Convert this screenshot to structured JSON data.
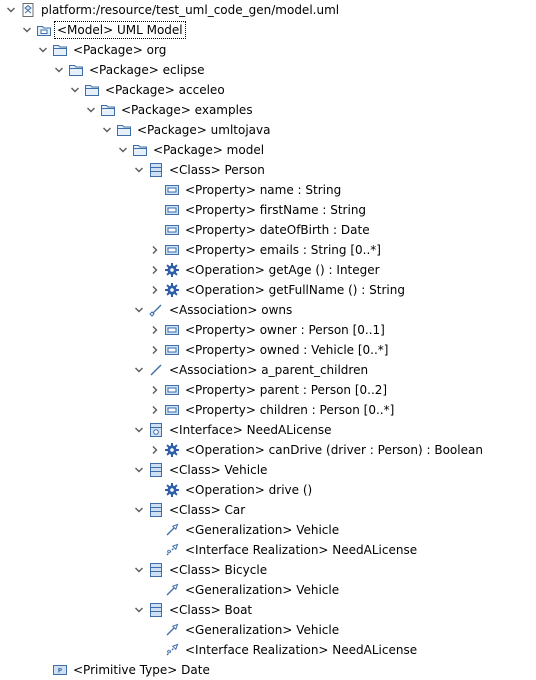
{
  "colors": {
    "background": "#ffffff",
    "text": "#000000",
    "twisty": "#5a5a5a",
    "icon_blue": "#3e6ea8",
    "icon_fill": "#cfe0f3",
    "folder_fill": "#e6f0fb",
    "gear": "#2f5fa7"
  },
  "tree": [
    {
      "depth": 0,
      "expander": "expanded",
      "icon": "resource-icon",
      "label": "platform:/resource/test_uml_code_gen/model.uml"
    },
    {
      "depth": 1,
      "expander": "expanded",
      "icon": "model-icon",
      "label": "<Model> UML Model",
      "selected": true
    },
    {
      "depth": 2,
      "expander": "expanded",
      "icon": "package-icon",
      "label": "<Package> org"
    },
    {
      "depth": 3,
      "expander": "expanded",
      "icon": "package-icon",
      "label": "<Package> eclipse"
    },
    {
      "depth": 4,
      "expander": "expanded",
      "icon": "package-icon",
      "label": "<Package> acceleo"
    },
    {
      "depth": 5,
      "expander": "expanded",
      "icon": "package-icon",
      "label": "<Package> examples"
    },
    {
      "depth": 6,
      "expander": "expanded",
      "icon": "package-icon",
      "label": "<Package> umltojava"
    },
    {
      "depth": 7,
      "expander": "expanded",
      "icon": "package-icon",
      "label": "<Package> model"
    },
    {
      "depth": 8,
      "expander": "expanded",
      "icon": "class-icon",
      "label": "<Class> Person"
    },
    {
      "depth": 9,
      "expander": "none",
      "icon": "property-icon",
      "label": "<Property> name : String"
    },
    {
      "depth": 9,
      "expander": "none",
      "icon": "property-icon",
      "label": "<Property> firstName : String"
    },
    {
      "depth": 9,
      "expander": "none",
      "icon": "property-icon",
      "label": "<Property> dateOfBirth : Date"
    },
    {
      "depth": 9,
      "expander": "collapsed",
      "icon": "property-icon",
      "label": "<Property> emails : String [0..*]"
    },
    {
      "depth": 9,
      "expander": "collapsed",
      "icon": "operation-icon",
      "label": "<Operation> getAge () : Integer"
    },
    {
      "depth": 9,
      "expander": "collapsed",
      "icon": "operation-icon",
      "label": "<Operation> getFullName () : String"
    },
    {
      "depth": 8,
      "expander": "expanded",
      "icon": "association-icon",
      "label": "<Association> owns"
    },
    {
      "depth": 9,
      "expander": "collapsed",
      "icon": "property-icon",
      "label": "<Property> owner : Person [0..1]"
    },
    {
      "depth": 9,
      "expander": "collapsed",
      "icon": "property-icon",
      "label": "<Property> owned : Vehicle [0..*]"
    },
    {
      "depth": 8,
      "expander": "expanded",
      "icon": "association-line-icon",
      "label": "<Association> a_parent_children"
    },
    {
      "depth": 9,
      "expander": "collapsed",
      "icon": "property-icon",
      "label": "<Property> parent : Person [0..2]"
    },
    {
      "depth": 9,
      "expander": "collapsed",
      "icon": "property-icon",
      "label": "<Property> children : Person [0..*]"
    },
    {
      "depth": 8,
      "expander": "expanded",
      "icon": "interface-icon",
      "label": "<Interface> NeedALicense"
    },
    {
      "depth": 9,
      "expander": "collapsed",
      "icon": "operation-icon",
      "label": "<Operation> canDrive (driver : Person) : Boolean"
    },
    {
      "depth": 8,
      "expander": "expanded",
      "icon": "class-icon",
      "label": "<Class> Vehicle"
    },
    {
      "depth": 9,
      "expander": "none",
      "icon": "operation-icon",
      "label": "<Operation> drive ()"
    },
    {
      "depth": 8,
      "expander": "expanded",
      "icon": "class-icon",
      "label": "<Class> Car"
    },
    {
      "depth": 9,
      "expander": "none",
      "icon": "generalization-icon",
      "label": "<Generalization> Vehicle"
    },
    {
      "depth": 9,
      "expander": "none",
      "icon": "interface-realization-icon",
      "label": "<Interface Realization> NeedALicense"
    },
    {
      "depth": 8,
      "expander": "expanded",
      "icon": "class-icon",
      "label": "<Class> Bicycle"
    },
    {
      "depth": 9,
      "expander": "none",
      "icon": "generalization-icon",
      "label": "<Generalization> Vehicle"
    },
    {
      "depth": 8,
      "expander": "expanded",
      "icon": "class-icon",
      "label": "<Class> Boat"
    },
    {
      "depth": 9,
      "expander": "none",
      "icon": "generalization-icon",
      "label": "<Generalization> Vehicle"
    },
    {
      "depth": 9,
      "expander": "none",
      "icon": "interface-realization-icon",
      "label": "<Interface Realization> NeedALicense"
    },
    {
      "depth": 2,
      "expander": "none",
      "icon": "primitive-type-icon",
      "label": "<Primitive Type> Date"
    }
  ]
}
